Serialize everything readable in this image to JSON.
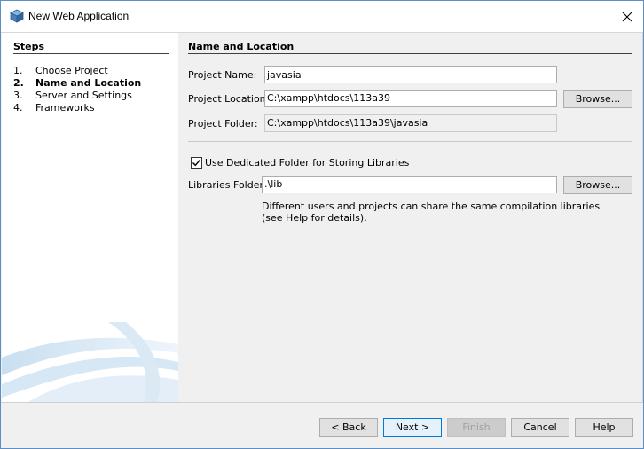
{
  "window": {
    "title": "New Web Application"
  },
  "steps": {
    "heading": "Steps",
    "items": [
      {
        "num": "1.",
        "label": "Choose Project"
      },
      {
        "num": "2.",
        "label": "Name and Location"
      },
      {
        "num": "3.",
        "label": "Server and Settings"
      },
      {
        "num": "4.",
        "label": "Frameworks"
      }
    ]
  },
  "main": {
    "heading": "Name and Location",
    "project_name": {
      "label": "Project Name:",
      "value": "javasia"
    },
    "project_location": {
      "label": "Project Location:",
      "value": "C:\\xampp\\htdocs\\113a39"
    },
    "project_folder": {
      "label": "Project Folder:",
      "value": "C:\\xampp\\htdocs\\113a39\\javasia"
    },
    "browse_label": "Browse...",
    "dedicated_folder": {
      "label": "Use Dedicated Folder for Storing Libraries",
      "checked": true
    },
    "libraries_folder": {
      "label": "Libraries Folder:",
      "value": ".\\lib"
    },
    "help_line1": "Different users and projects can share the same compilation libraries",
    "help_line2": "(see Help for details)."
  },
  "buttons": {
    "back": "< Back",
    "next": "Next >",
    "finish": "Finish",
    "cancel": "Cancel",
    "help": "Help"
  }
}
